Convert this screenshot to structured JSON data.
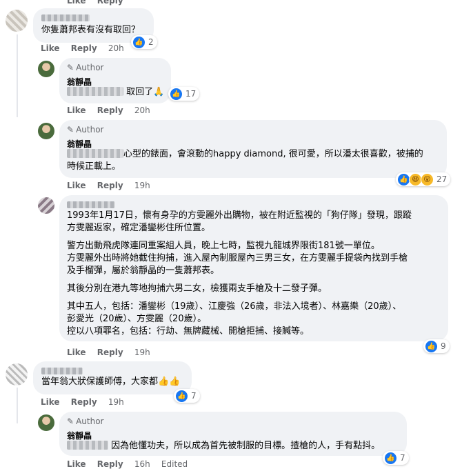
{
  "top_actions": {
    "like": "Like",
    "reply": "Reply"
  },
  "comments": [
    {
      "text": "你隻蕭邦表有沒有取回？",
      "actions": {
        "like": "Like",
        "reply": "Reply",
        "time": "20h"
      },
      "reactions": {
        "count": "2",
        "icons": [
          "like-icon"
        ]
      }
    },
    {
      "badge": "Author",
      "name": "翁靜晶",
      "text": "取回了🙏",
      "actions": {
        "like": "Like",
        "reply": "Reply",
        "time": "20h"
      },
      "reactions": {
        "count": "17",
        "icons": [
          "like-icon"
        ]
      }
    },
    {
      "badge": "Author",
      "name": "翁靜晶",
      "text_line1": "心型的錶面，會滾動的happy diamond, 很可愛，所以潘太很喜歡，被捕的",
      "text_line2": "時候正載上。",
      "actions": {
        "like": "Like",
        "reply": "Reply",
        "time": "19h"
      },
      "reactions": {
        "count": "27",
        "icons": [
          "like-icon",
          "haha-icon",
          "wow-icon"
        ]
      }
    },
    {
      "paragraphs": [
        [
          "1993年1月17日，懷有身孕的方雯麗外出購物，被在附近監視的「狗仔隊」發現，跟蹤",
          "方雯麗返家，確定潘鑾彬住所位置。"
        ],
        [
          "警方出動飛虎隊連同重案組人員，晚上七時，監視九龍城界限街181號一單位。",
          "方雯麗外出時將她截住拘捕，進入屋內制服屋內三男三女，在方雯麗手提袋內找到手槍",
          "及手榴彈，屬於翁靜晶的一隻蕭邦表。"
        ],
        [
          "其後分別在港九等地拘捕六男二女，檢獲兩支手槍及十二發子彈。"
        ],
        [
          "其中五人，包括：潘鑾彬（19歲）、江慶強（26歲，非法入境者）、林嘉樂（20歲）、",
          "彭愛光（20歲）、方雯麗（20歲）。",
          "控以八項罪名，包括：行劫、無牌藏械、開槍拒捕、接贓等。"
        ]
      ],
      "actions": {
        "like": "Like",
        "reply": "Reply",
        "time": "19h"
      },
      "reactions": {
        "count": "9",
        "icons": [
          "like-icon"
        ]
      }
    },
    {
      "text": "當年翁大狀保護師傅，大家都👍👍",
      "actions": {
        "like": "Like",
        "reply": "Reply",
        "time": "19h"
      },
      "reactions": {
        "count": "7",
        "icons": [
          "like-icon"
        ]
      }
    },
    {
      "badge": "Author",
      "name": "翁靜晶",
      "text": "因為他懂功夫，所以成為首先被制服的目標。揸槍的人，手有點抖。",
      "actions": {
        "like": "Like",
        "reply": "Reply",
        "time": "16h",
        "edited": "Edited"
      },
      "reactions": {
        "count": "7",
        "icons": [
          "like-icon"
        ]
      }
    }
  ],
  "colors": {
    "bubble": "#f0f2f5",
    "like_blue": "#1877f2",
    "meta_gray": "#65676b"
  }
}
